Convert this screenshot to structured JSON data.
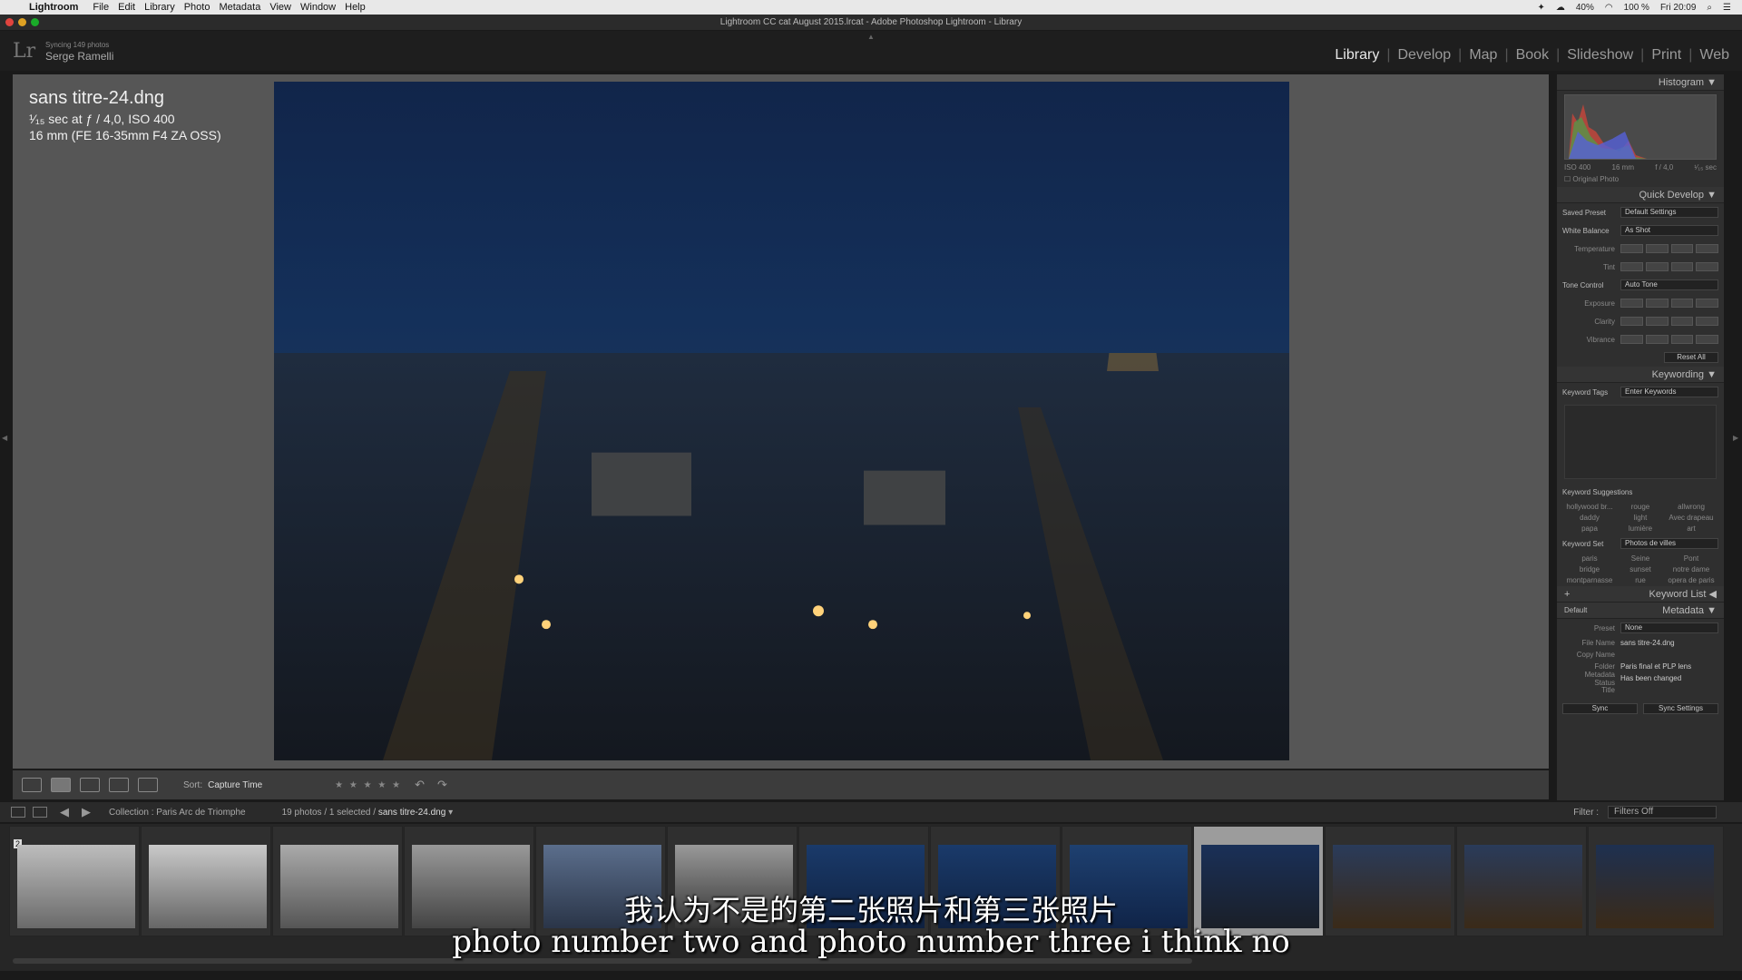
{
  "menubar": {
    "app": "Lightroom",
    "items": [
      "File",
      "Edit",
      "Library",
      "Photo",
      "Metadata",
      "View",
      "Window",
      "Help"
    ],
    "battery": "40%",
    "battery2": "100 %",
    "clock": "Fri 20:09"
  },
  "window": {
    "title": "Lightroom CC cat August 2015.lrcat - Adobe Photoshop Lightroom - Library"
  },
  "identity": {
    "logo": "Lr",
    "sync_status": "Syncing 149 photos",
    "user": "Serge Ramelli",
    "modules": [
      "Library",
      "Develop",
      "Map",
      "Book",
      "Slideshow",
      "Print",
      "Web"
    ],
    "active_module": "Library"
  },
  "info": {
    "filename": "sans titre-24.dng",
    "exposure": "¹⁄₁₅ sec at ƒ / 4,0, ISO 400",
    "lens": "16 mm (FE 16-35mm F4 ZA OSS)"
  },
  "toolbar": {
    "sort_label": "Sort:",
    "sort_value": "Capture Time",
    "stars": "★ ★ ★ ★ ★"
  },
  "right_panel": {
    "histogram_title": "Histogram",
    "histo_meta": [
      "ISO 400",
      "16 mm",
      "f / 4,0",
      "¹⁄₁₅ sec"
    ],
    "original_photo": "Original Photo",
    "quick_develop_title": "Quick Develop",
    "saved_preset_label": "Saved Preset",
    "saved_preset_value": "Default Settings",
    "white_balance_label": "White Balance",
    "white_balance_value": "As Shot",
    "temperature_label": "Temperature",
    "tint_label": "Tint",
    "tone_control_label": "Tone Control",
    "auto_tone": "Auto Tone",
    "exposure_label": "Exposure",
    "clarity_label": "Clarity",
    "vibrance_label": "Vibrance",
    "reset_all": "Reset All",
    "keywording_title": "Keywording",
    "keyword_tags_label": "Keyword Tags",
    "keyword_tags_value": "Enter Keywords",
    "keyword_suggestions_label": "Keyword Suggestions",
    "suggestions": [
      "hollywood br...",
      "rouge",
      "allwrong",
      "daddy",
      "light",
      "Avec drapeau",
      "papa",
      "lumière",
      "art"
    ],
    "keyword_set_label": "Keyword Set",
    "keyword_set_value": "Photos de villes",
    "keyword_set_items": [
      "paris",
      "Seine",
      "Pont",
      "bridge",
      "sunset",
      "notre dame",
      "montparnasse",
      "rue",
      "opera de paris"
    ],
    "keyword_list_title": "Keyword List",
    "metadata_title": "Metadata",
    "metadata_default": "Default",
    "preset_label": "Preset",
    "preset_value": "None",
    "file_name_label": "File Name",
    "file_name_value": "sans titre-24.dng",
    "copy_name_label": "Copy Name",
    "folder_label": "Folder",
    "folder_value": "Paris final et PLP lens",
    "metadata_status_label": "Metadata Status",
    "metadata_status_value": "Has been changed",
    "title_label": "Title",
    "sync_button": "Sync",
    "sync_settings_button": "Sync Settings"
  },
  "filmstrip": {
    "collection": "Collection : Paris Arc de Triomphe",
    "count": "19 photos / 1 selected /",
    "selected_file": "sans titre-24.dng",
    "filter_label": "Filter :",
    "filter_value": "Filters Off",
    "first_badge": "2"
  },
  "subtitles": {
    "zh": "我认为不是的第二张照片和第三张照片",
    "en": "photo number two and photo number three i think no"
  }
}
